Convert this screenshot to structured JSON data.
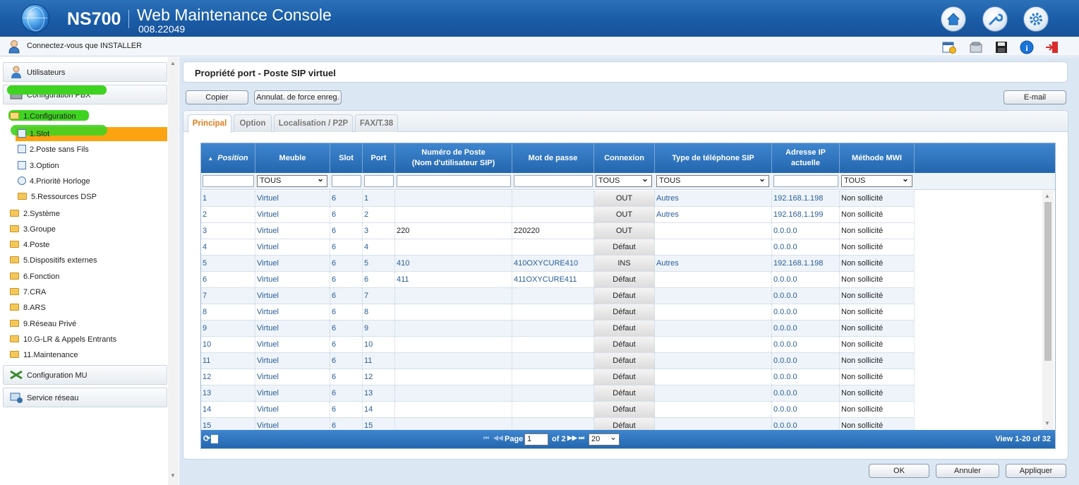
{
  "header": {
    "model": "NS700",
    "title": "Web Maintenance Console",
    "version": "008.22049",
    "buttons": [
      "home-icon",
      "wrench-icon",
      "gear-icon"
    ]
  },
  "userbar": {
    "login_text": "Connectez-vous que INSTALLER",
    "tools": [
      "calendar-alert-icon",
      "phone-icon",
      "save-icon",
      "info-icon",
      "logout-icon"
    ]
  },
  "sidebar": {
    "sections": [
      {
        "label": "Utilisateurs"
      },
      {
        "label": "Configuration PBX"
      },
      {
        "label": "Configuration MU"
      },
      {
        "label": "Service réseau"
      }
    ],
    "tree": [
      {
        "label": "1.Configuration"
      },
      {
        "label": "1.Slot"
      },
      {
        "label": "2.Poste sans Fils"
      },
      {
        "label": "3.Option"
      },
      {
        "label": "4.Priorité Horloge"
      },
      {
        "label": "5.Ressources DSP"
      },
      {
        "label": "2.Système"
      },
      {
        "label": "3.Groupe"
      },
      {
        "label": "4.Poste"
      },
      {
        "label": "5.Dispositifs externes"
      },
      {
        "label": "6.Fonction"
      },
      {
        "label": "7.CRA"
      },
      {
        "label": "8.ARS"
      },
      {
        "label": "9.Réseau Privé"
      },
      {
        "label": "10.G-LR & Appels Entrants"
      },
      {
        "label": "11.Maintenance"
      }
    ]
  },
  "page": {
    "title": "Propriété port - Poste SIP virtuel",
    "copy_button": "Copier",
    "force_button": "Annulat. de force enreg.",
    "email_button": "E-mail",
    "tabs": [
      "Principal",
      "Option",
      "Localisation / P2P",
      "FAX/T.38"
    ]
  },
  "grid": {
    "columns": [
      "Position",
      "Meuble",
      "Slot",
      "Port",
      "Numéro de Poste\n(Nom d'utilisateur SIP)",
      "Mot de passe",
      "Connexion",
      "Type de téléphone SIP",
      "Adresse IP\nactuelle",
      "Méthode MWI"
    ],
    "filters": {
      "meuble": "TOUS",
      "connexion": "TOUS",
      "type": "TOUS",
      "mwi": "TOUS"
    },
    "rows": [
      {
        "pos": "1",
        "meuble": "Virtuel",
        "slot": "6",
        "port": "1",
        "num": "",
        "pwd": "",
        "conn": "OUT",
        "type": "Autres",
        "ip": "192.168.1.198",
        "mwi": "Non sollicité"
      },
      {
        "pos": "2",
        "meuble": "Virtuel",
        "slot": "6",
        "port": "2",
        "num": "",
        "pwd": "",
        "conn": "OUT",
        "type": "Autres",
        "ip": "192.168.1.199",
        "mwi": "Non sollicité"
      },
      {
        "pos": "3",
        "meuble": "Virtuel",
        "slot": "6",
        "port": "3",
        "num": "220",
        "pwd": "220220",
        "conn": "OUT",
        "type": "",
        "ip": "0.0.0.0",
        "mwi": "Non sollicité"
      },
      {
        "pos": "4",
        "meuble": "Virtuel",
        "slot": "6",
        "port": "4",
        "num": "",
        "pwd": "",
        "conn": "Défaut",
        "type": "",
        "ip": "0.0.0.0",
        "mwi": "Non sollicité"
      },
      {
        "pos": "5",
        "meuble": "Virtuel",
        "slot": "6",
        "port": "5",
        "num": "410",
        "pwd": "410OXYCURE410",
        "conn": "INS",
        "type": "Autres",
        "ip": "192.168.1.198",
        "mwi": "Non sollicité"
      },
      {
        "pos": "6",
        "meuble": "Virtuel",
        "slot": "6",
        "port": "6",
        "num": "411",
        "pwd": "411OXYCURE411",
        "conn": "Défaut",
        "type": "",
        "ip": "0.0.0.0",
        "mwi": "Non sollicité"
      },
      {
        "pos": "7",
        "meuble": "Virtuel",
        "slot": "6",
        "port": "7",
        "num": "",
        "pwd": "",
        "conn": "Défaut",
        "type": "",
        "ip": "0.0.0.0",
        "mwi": "Non sollicité"
      },
      {
        "pos": "8",
        "meuble": "Virtuel",
        "slot": "6",
        "port": "8",
        "num": "",
        "pwd": "",
        "conn": "Défaut",
        "type": "",
        "ip": "0.0.0.0",
        "mwi": "Non sollicité"
      },
      {
        "pos": "9",
        "meuble": "Virtuel",
        "slot": "6",
        "port": "9",
        "num": "",
        "pwd": "",
        "conn": "Défaut",
        "type": "",
        "ip": "0.0.0.0",
        "mwi": "Non sollicité"
      },
      {
        "pos": "10",
        "meuble": "Virtuel",
        "slot": "6",
        "port": "10",
        "num": "",
        "pwd": "",
        "conn": "Défaut",
        "type": "",
        "ip": "0.0.0.0",
        "mwi": "Non sollicité"
      },
      {
        "pos": "11",
        "meuble": "Virtuel",
        "slot": "6",
        "port": "11",
        "num": "",
        "pwd": "",
        "conn": "Défaut",
        "type": "",
        "ip": "0.0.0.0",
        "mwi": "Non sollicité"
      },
      {
        "pos": "12",
        "meuble": "Virtuel",
        "slot": "6",
        "port": "12",
        "num": "",
        "pwd": "",
        "conn": "Défaut",
        "type": "",
        "ip": "0.0.0.0",
        "mwi": "Non sollicité"
      },
      {
        "pos": "13",
        "meuble": "Virtuel",
        "slot": "6",
        "port": "13",
        "num": "",
        "pwd": "",
        "conn": "Défaut",
        "type": "",
        "ip": "0.0.0.0",
        "mwi": "Non sollicité"
      },
      {
        "pos": "14",
        "meuble": "Virtuel",
        "slot": "6",
        "port": "14",
        "num": "",
        "pwd": "",
        "conn": "Défaut",
        "type": "",
        "ip": "0.0.0.0",
        "mwi": "Non sollicité"
      },
      {
        "pos": "15",
        "meuble": "Virtuel",
        "slot": "6",
        "port": "15",
        "num": "",
        "pwd": "",
        "conn": "Défaut",
        "type": "",
        "ip": "0.0.0.0",
        "mwi": "Non sollicité"
      }
    ],
    "pager": {
      "page_label": "Page",
      "page_value": "1",
      "of_label": "of 2",
      "page_size": "20",
      "view_text": "View 1-20 of 32"
    }
  },
  "footer": {
    "ok": "OK",
    "cancel": "Annuler",
    "apply": "Appliquer"
  }
}
